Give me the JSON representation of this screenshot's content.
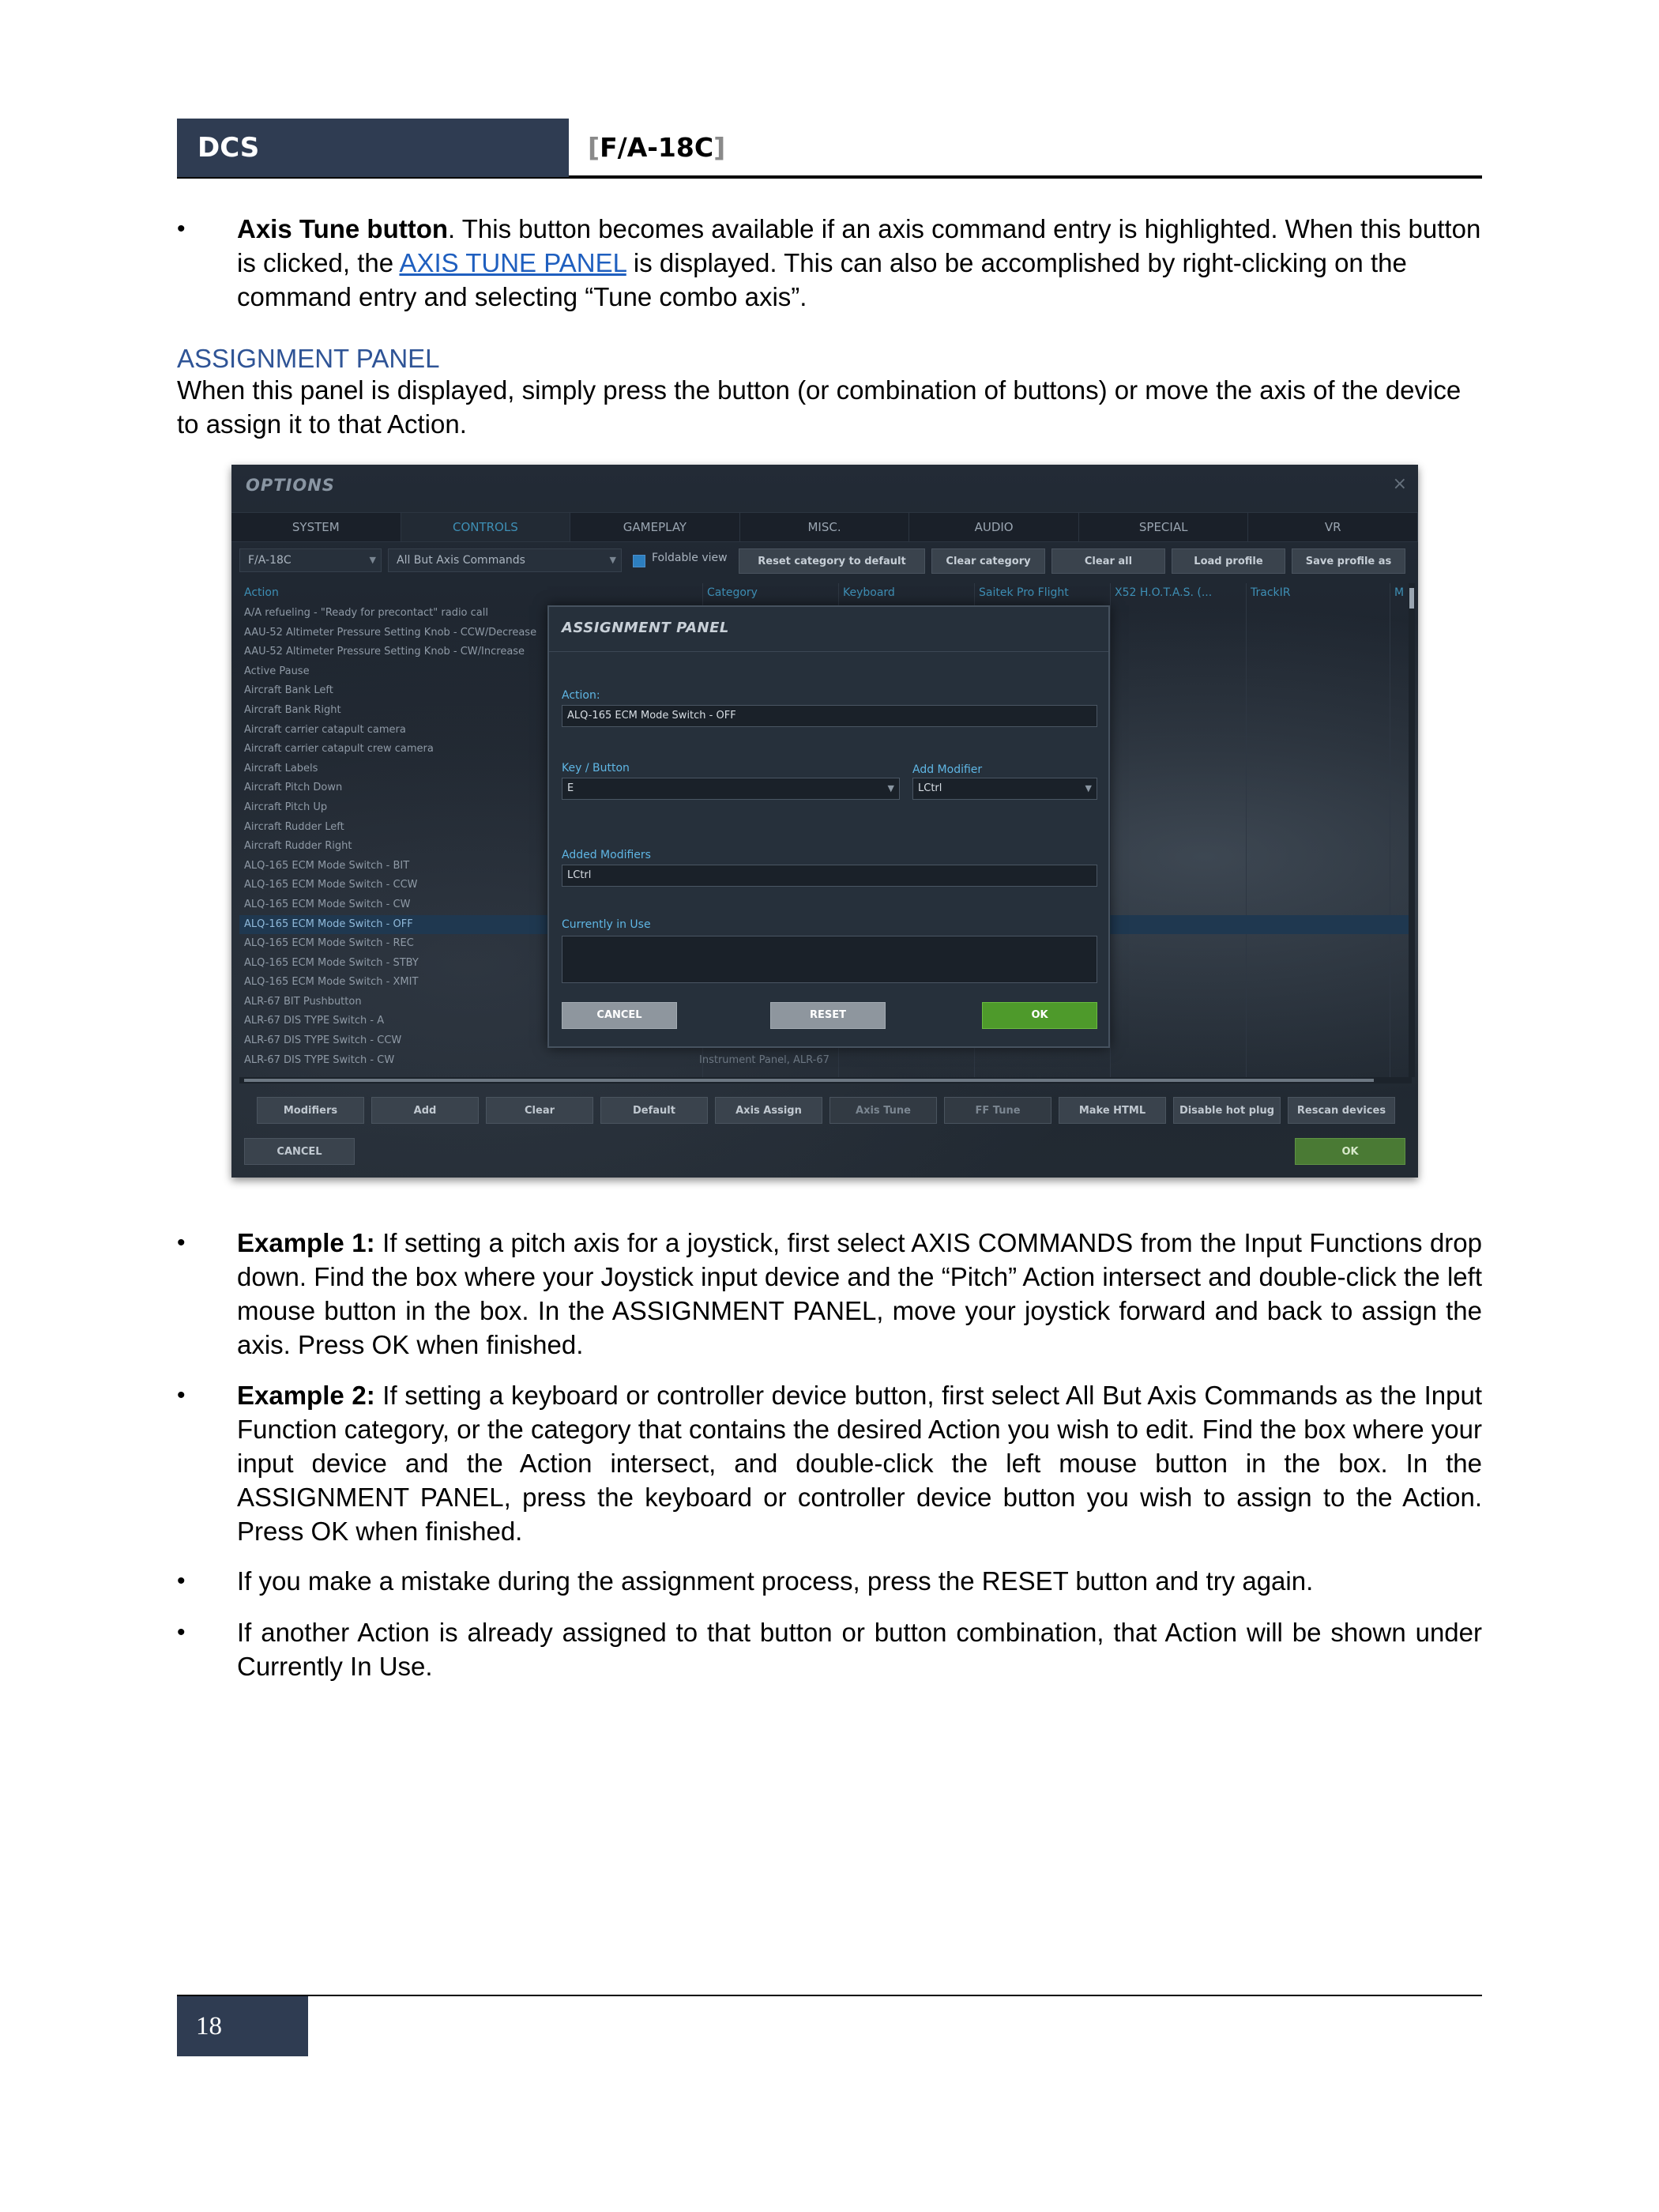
{
  "header": {
    "left": "DCS",
    "bracket_open": "[",
    "title": "F/A-18C",
    "bracket_close": "]"
  },
  "axis_tune": {
    "bold": "Axis Tune button",
    "pre": ". This button becomes available if an axis command entry is highlighted. When this button is clicked, the ",
    "link": "AXIS TUNE PANEL",
    "post": " is displayed. This can also be accomplished by right-clicking on the command entry and selecting “Tune combo axis”."
  },
  "section_heading": "ASSIGNMENT PANEL",
  "section_intro": "When this panel is displayed, simply press the button (or combination of buttons) or move the axis of the device to assign it to that Action.",
  "screenshot": {
    "window_title": "OPTIONS",
    "close_glyph": "×",
    "tabs": [
      "SYSTEM",
      "CONTROLS",
      "GAMEPLAY",
      "MISC.",
      "AUDIO",
      "SPECIAL",
      "VR"
    ],
    "aircraft_select": "F/A-18C",
    "category_select": "All But Axis Commands",
    "foldable_label": "Foldable view",
    "toolbar_buttons": [
      "Reset category to default",
      "Clear category",
      "Clear all",
      "Load profile",
      "Save profile as"
    ],
    "columns": [
      "Action",
      "Category",
      "Keyboard",
      "Saitek Pro Flight",
      "X52 H.O.T.A.S. (...",
      "TrackIR",
      "M"
    ],
    "actions": [
      "A/A refueling - \"Ready for precontact\" radio call",
      "AAU-52 Altimeter Pressure Setting Knob - CCW/Decrease",
      "AAU-52 Altimeter Pressure Setting Knob - CW/Increase",
      "Active Pause",
      "Aircraft Bank Left",
      "Aircraft Bank Right",
      "Aircraft carrier catapult camera",
      "Aircraft carrier catapult crew camera",
      "Aircraft Labels",
      "Aircraft Pitch Down",
      "Aircraft Pitch Up",
      "Aircraft Rudder Left",
      "Aircraft Rudder Right",
      "ALQ-165 ECM Mode Switch - BIT",
      "ALQ-165 ECM Mode Switch - CCW",
      "ALQ-165 ECM Mode Switch - CW",
      "ALQ-165 ECM Mode Switch - OFF",
      "ALQ-165 ECM Mode Switch - REC",
      "ALQ-165 ECM Mode Switch - STBY",
      "ALQ-165 ECM Mode Switch - XMIT",
      "ALR-67 BIT Pushbutton",
      "ALR-67 DIS TYPE Switch - A",
      "ALR-67 DIS TYPE Switch - CCW",
      "ALR-67 DIS TYPE Switch - CW"
    ],
    "selected_row_index": 16,
    "visible_categories": [
      {
        "row": 22,
        "text": "Instrument Panel, ALR-67"
      },
      {
        "row": 23,
        "text": "Instrument Panel, ALR-67"
      }
    ],
    "bottom_buttons": [
      "Modifiers",
      "Add",
      "Clear",
      "Default",
      "Axis Assign",
      "Axis Tune",
      "FF Tune",
      "Make HTML",
      "Disable hot plug",
      "Rescan devices"
    ],
    "disabled_bottom": [
      "Axis Tune",
      "FF Tune"
    ],
    "cancel_label": "CANCEL",
    "ok_label": "OK",
    "dialog": {
      "title": "ASSIGNMENT PANEL",
      "action_label": "Action:",
      "action_value": "ALQ-165 ECM Mode Switch - OFF",
      "key_label": "Key / Button",
      "key_value": "E",
      "modifier_label": "Add Modifier",
      "modifier_value": "LCtrl",
      "added_label": "Added Modifiers",
      "added_value": "LCtrl",
      "in_use_label": "Currently in Use",
      "in_use_value": "",
      "cancel": "CANCEL",
      "reset": "RESET",
      "ok": "OK"
    }
  },
  "examples": [
    {
      "bold": "Example 1:",
      "text": " If setting a pitch axis for a joystick, first select AXIS COMMANDS from the Input Functions drop down. Find the box where your Joystick input device and the “Pitch” Action intersect and double-click the left mouse button in the box. In the ASSIGNMENT PANEL, move your joystick forward and back to assign the axis. Press OK when finished."
    },
    {
      "bold": "Example 2:",
      "text": " If setting a keyboard or controller device button, first select All But Axis Commands as the Input Function category, or the category that contains the desired Action you wish to edit. Find the box where your input device and the Action intersect, and double-click the left mouse button in the box. In the ASSIGNMENT PANEL, press the keyboard or controller device button you wish to assign to the Action. Press OK when finished."
    }
  ],
  "notes": [
    "If you make a mistake during the assignment process, press the RESET button and try again.",
    "If another Action is already assigned to that button or button combination, that Action will be shown under Currently In Use."
  ],
  "bullet_glyph": "•",
  "page_number": "18"
}
